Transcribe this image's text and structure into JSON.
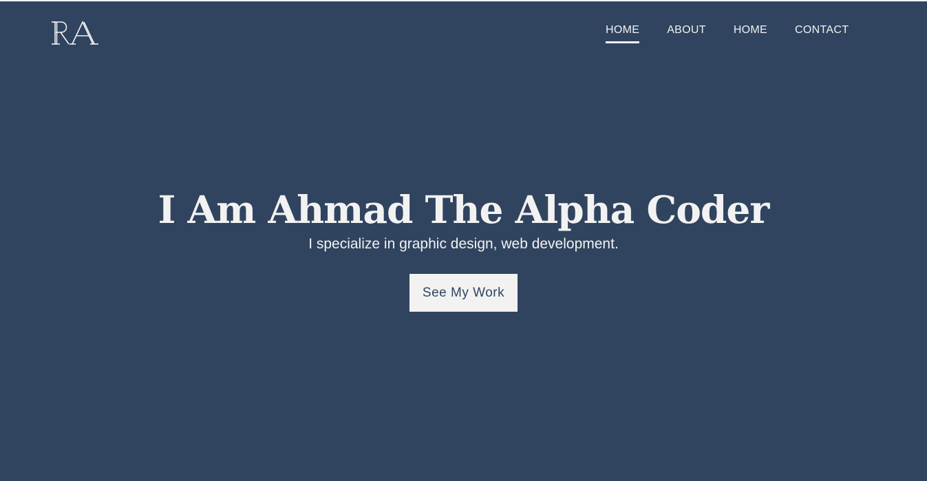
{
  "logo": {
    "text": "RA"
  },
  "nav": {
    "items": [
      {
        "label": "HOME",
        "active": true
      },
      {
        "label": "ABOUT",
        "active": false
      },
      {
        "label": "HOME",
        "active": false
      },
      {
        "label": "CONTACT",
        "active": false
      }
    ]
  },
  "hero": {
    "title": "I Am Ahmad The Alpha Coder",
    "subtitle": "I specialize in graphic design, web development.",
    "cta_label": "See My Work"
  },
  "colors": {
    "background": "#30445f",
    "text": "#f2f2f2",
    "button_bg": "#f2f2f2",
    "button_text": "#30445f"
  }
}
